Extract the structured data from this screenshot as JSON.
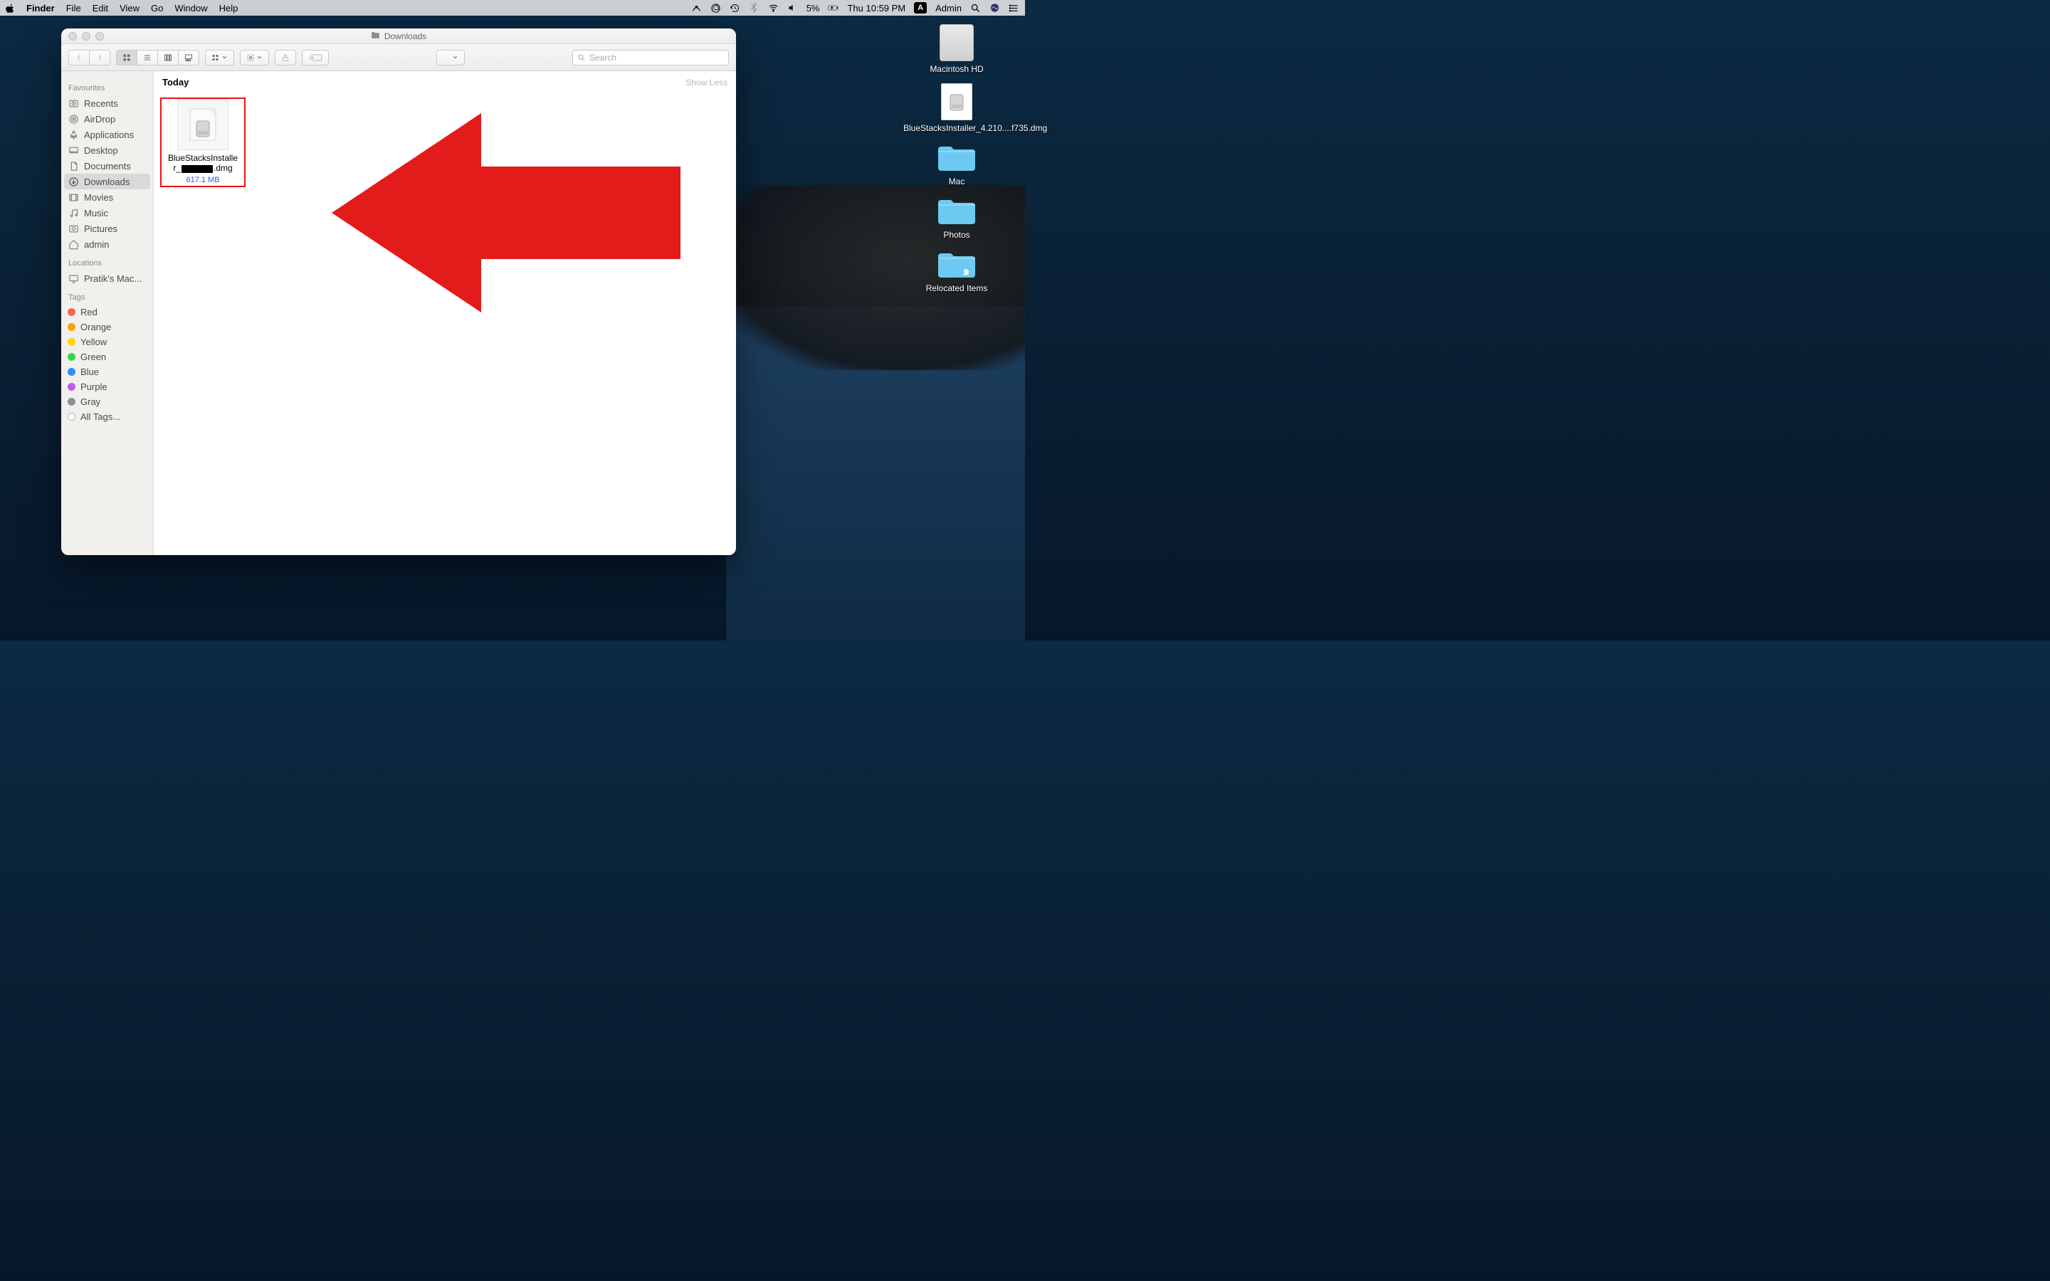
{
  "menubar": {
    "app": "Finder",
    "items": [
      "File",
      "Edit",
      "View",
      "Go",
      "Window",
      "Help"
    ],
    "battery_pct": "5%",
    "clock": "Thu 10:59 PM",
    "user": "Admin"
  },
  "window": {
    "title": "Downloads",
    "search_placeholder": "Search"
  },
  "sidebar": {
    "favourites_label": "Favourites",
    "favourites": [
      "Recents",
      "AirDrop",
      "Applications",
      "Desktop",
      "Documents",
      "Downloads",
      "Movies",
      "Music",
      "Pictures",
      "admin"
    ],
    "selected_index": 5,
    "locations_label": "Locations",
    "locations": [
      "Pratik's Mac..."
    ],
    "tags_label": "Tags",
    "tags": [
      {
        "name": "Red",
        "color": "#ff5f57"
      },
      {
        "name": "Orange",
        "color": "#ff9f0a"
      },
      {
        "name": "Yellow",
        "color": "#ffd60a"
      },
      {
        "name": "Green",
        "color": "#32d74b"
      },
      {
        "name": "Blue",
        "color": "#2e8cff"
      },
      {
        "name": "Purple",
        "color": "#bf5af2"
      },
      {
        "name": "Gray",
        "color": "#8e8e93"
      }
    ],
    "all_tags": "All Tags..."
  },
  "content": {
    "group_label": "Today",
    "show_less": "Show Less",
    "file_name_1": "BlueStacksInstalle",
    "file_name_2": "r_",
    "file_name_3": ".dmg",
    "file_size": "617.1 MB"
  },
  "desktop": {
    "hdd": "Macintosh HD",
    "dmg": "BlueStacksInstaller_4.210....f735.dmg",
    "folders": [
      "Mac",
      "Photos",
      "Relocated Items"
    ]
  }
}
